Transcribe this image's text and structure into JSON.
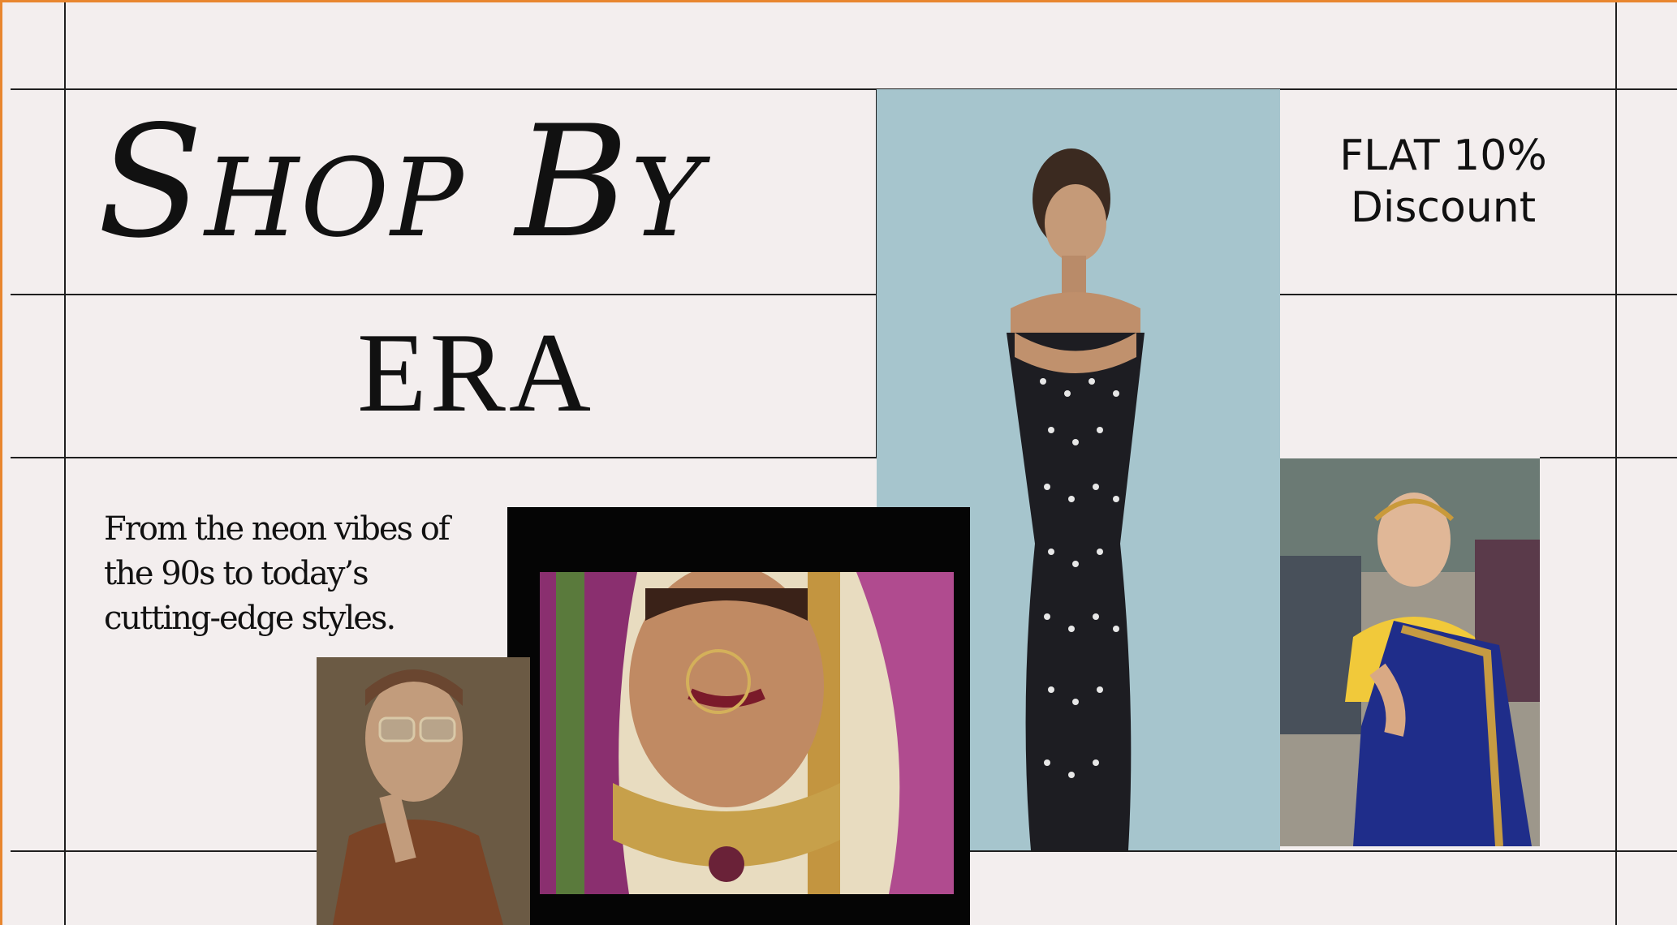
{
  "hero": {
    "title": "Shop By",
    "subtitle": "ERA",
    "tagline": "From the neon vibes of the 90s to today’s cutting-edge styles.",
    "offer_line1": "FLAT 10%",
    "offer_line2": "Discount"
  },
  "images": [
    {
      "name": "polka-dot-dress-model",
      "background": "#a8c7cf"
    },
    {
      "name": "bridal-jewelry-closeup",
      "background": "#d8c2a6"
    },
    {
      "name": "sari-model-portrait",
      "background": "#a9a196"
    },
    {
      "name": "sunglasses-model-portrait",
      "background": "#5c4a35"
    }
  ],
  "colors": {
    "background": "#f3eeee",
    "border_accent": "#e8862f",
    "grid_line": "#1f1f1f",
    "text": "#111111"
  }
}
